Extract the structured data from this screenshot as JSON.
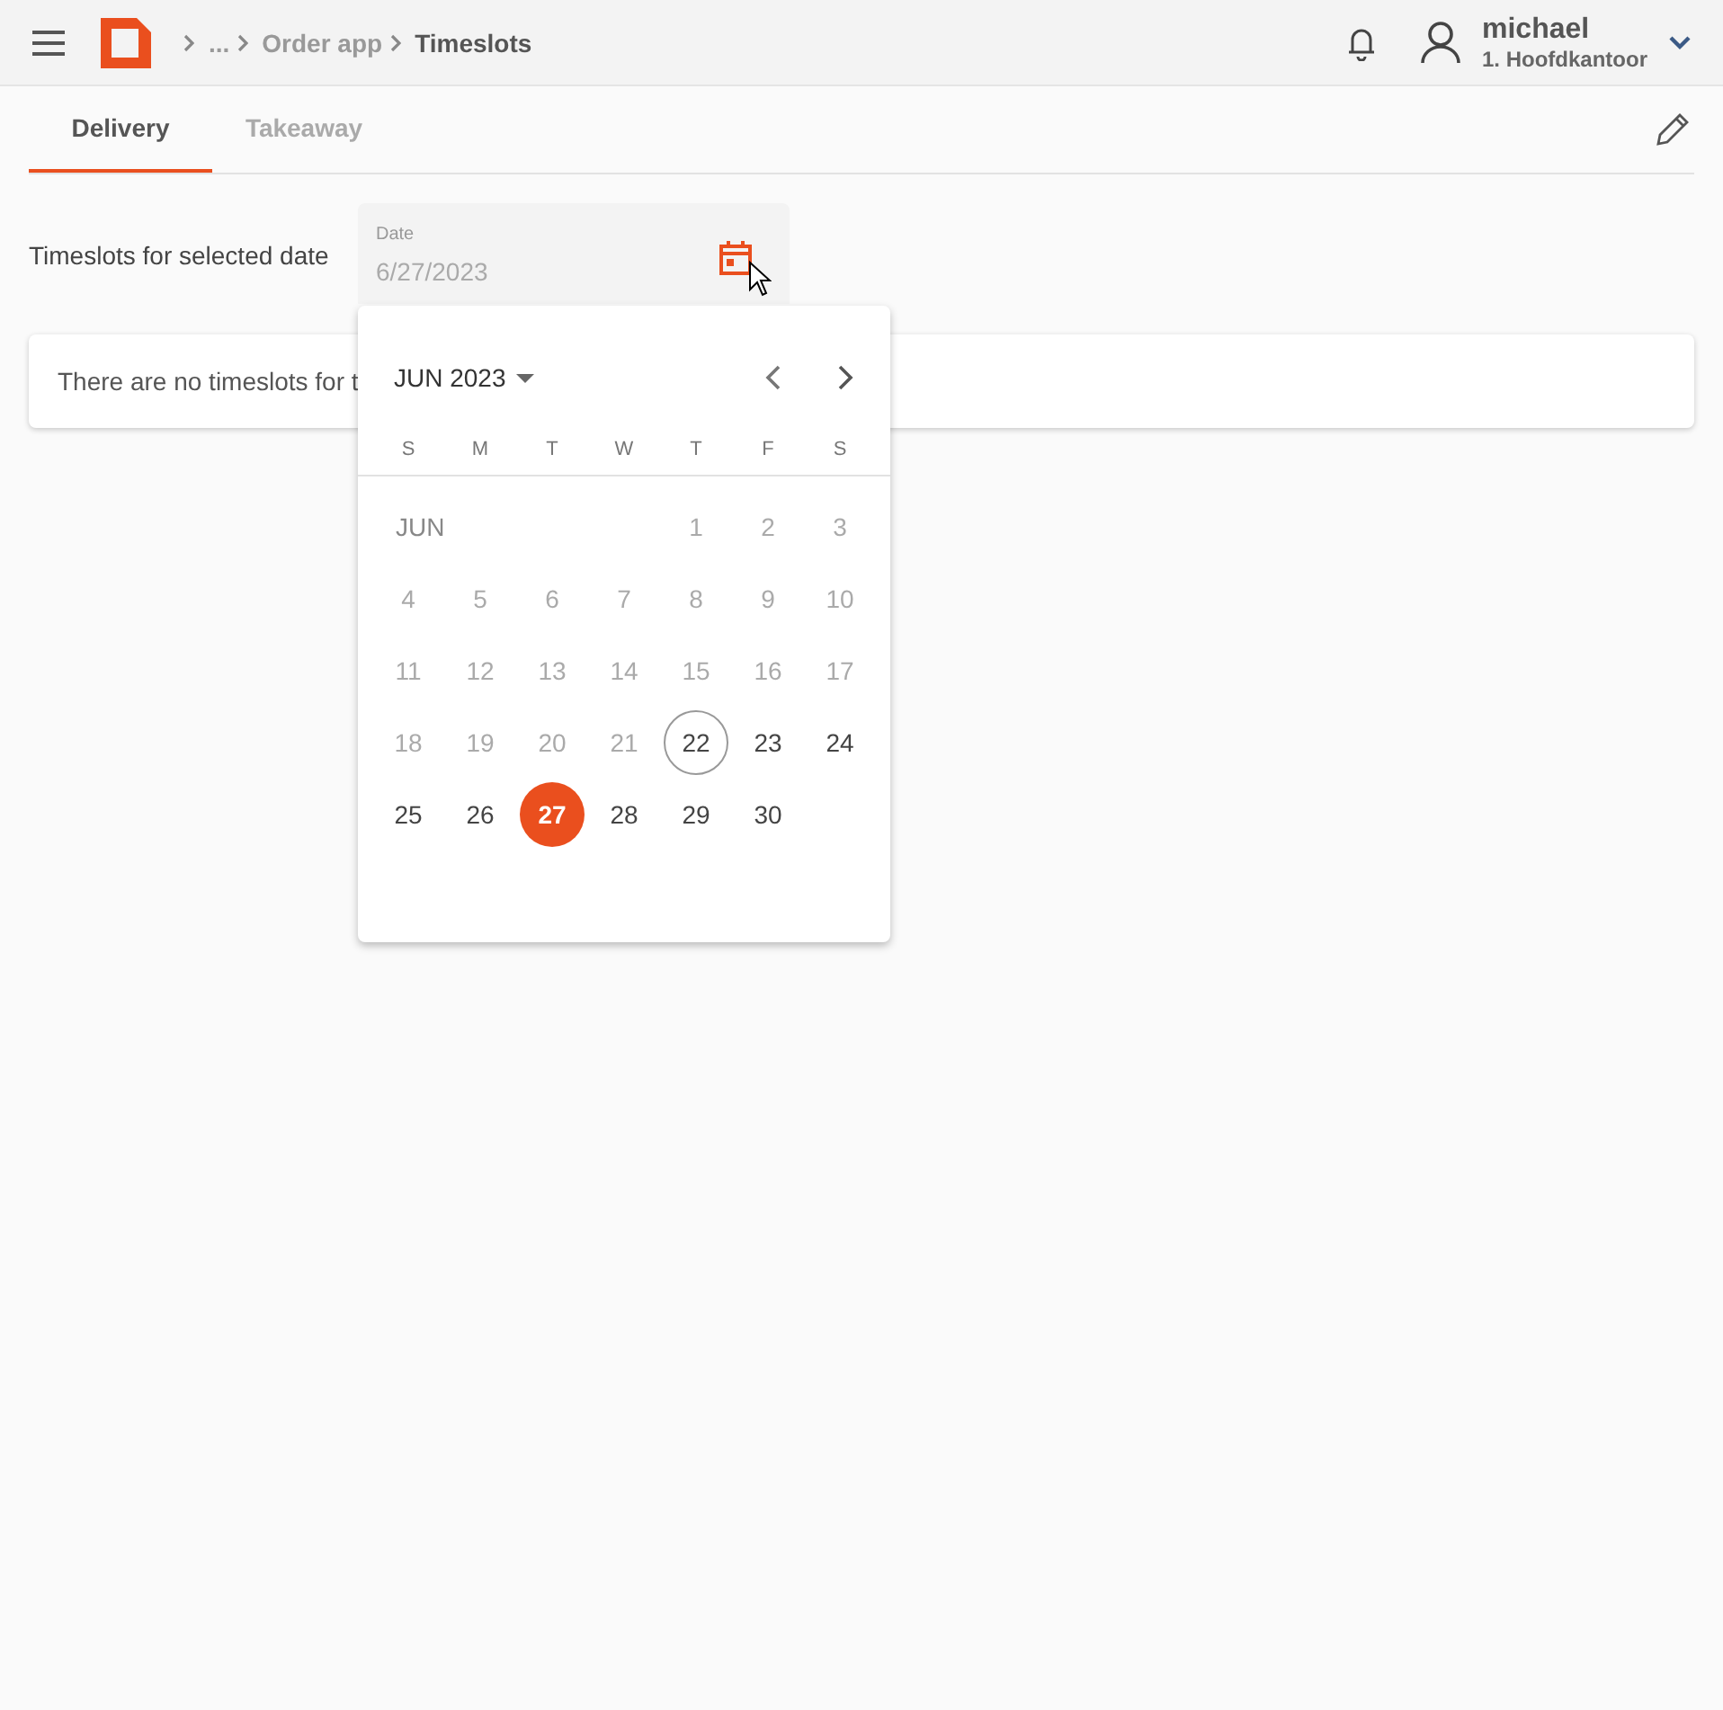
{
  "header": {
    "breadcrumbs": [
      {
        "label": "...",
        "current": false
      },
      {
        "label": "Order app",
        "current": false
      },
      {
        "label": "Timeslots",
        "current": true
      }
    ],
    "user": {
      "name": "michael",
      "location": "1. Hoofdkantoor"
    }
  },
  "tabs": [
    {
      "label": "Delivery",
      "selected": true
    },
    {
      "label": "Takeaway",
      "selected": false
    }
  ],
  "filter": {
    "label": "Timeslots for selected date",
    "date_field": {
      "label": "Date",
      "value": "6/27/2023"
    }
  },
  "message": "There are no timeslots for t",
  "calendar": {
    "month_year": "JUN 2023",
    "weekdays": [
      "S",
      "M",
      "T",
      "W",
      "T",
      "F",
      "S"
    ],
    "month_label": "JUN",
    "days": [
      {
        "label": "1",
        "disabled": true,
        "today": false,
        "selected": false
      },
      {
        "label": "2",
        "disabled": true,
        "today": false,
        "selected": false
      },
      {
        "label": "3",
        "disabled": true,
        "today": false,
        "selected": false
      },
      {
        "label": "4",
        "disabled": true,
        "today": false,
        "selected": false
      },
      {
        "label": "5",
        "disabled": true,
        "today": false,
        "selected": false
      },
      {
        "label": "6",
        "disabled": true,
        "today": false,
        "selected": false
      },
      {
        "label": "7",
        "disabled": true,
        "today": false,
        "selected": false
      },
      {
        "label": "8",
        "disabled": true,
        "today": false,
        "selected": false
      },
      {
        "label": "9",
        "disabled": true,
        "today": false,
        "selected": false
      },
      {
        "label": "10",
        "disabled": true,
        "today": false,
        "selected": false
      },
      {
        "label": "11",
        "disabled": true,
        "today": false,
        "selected": false
      },
      {
        "label": "12",
        "disabled": true,
        "today": false,
        "selected": false
      },
      {
        "label": "13",
        "disabled": true,
        "today": false,
        "selected": false
      },
      {
        "label": "14",
        "disabled": true,
        "today": false,
        "selected": false
      },
      {
        "label": "15",
        "disabled": true,
        "today": false,
        "selected": false
      },
      {
        "label": "16",
        "disabled": true,
        "today": false,
        "selected": false
      },
      {
        "label": "17",
        "disabled": true,
        "today": false,
        "selected": false
      },
      {
        "label": "18",
        "disabled": true,
        "today": false,
        "selected": false
      },
      {
        "label": "19",
        "disabled": true,
        "today": false,
        "selected": false
      },
      {
        "label": "20",
        "disabled": true,
        "today": false,
        "selected": false
      },
      {
        "label": "21",
        "disabled": true,
        "today": false,
        "selected": false
      },
      {
        "label": "22",
        "disabled": false,
        "today": true,
        "selected": false
      },
      {
        "label": "23",
        "disabled": false,
        "today": false,
        "selected": false
      },
      {
        "label": "24",
        "disabled": false,
        "today": false,
        "selected": false
      },
      {
        "label": "25",
        "disabled": false,
        "today": false,
        "selected": false
      },
      {
        "label": "26",
        "disabled": false,
        "today": false,
        "selected": false
      },
      {
        "label": "27",
        "disabled": false,
        "today": false,
        "selected": true
      },
      {
        "label": "28",
        "disabled": false,
        "today": false,
        "selected": false
      },
      {
        "label": "29",
        "disabled": false,
        "today": false,
        "selected": false
      },
      {
        "label": "30",
        "disabled": false,
        "today": false,
        "selected": false
      }
    ]
  }
}
